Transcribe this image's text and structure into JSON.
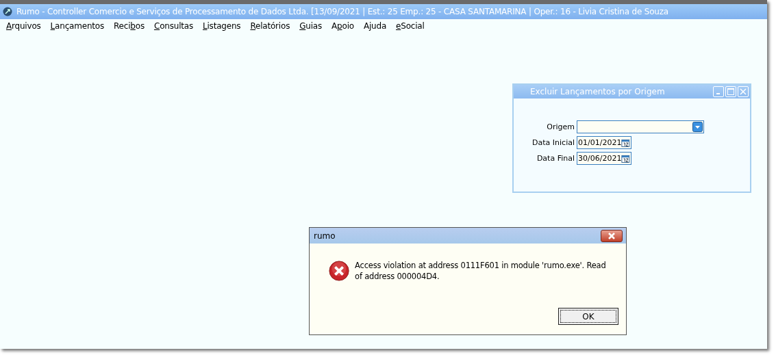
{
  "window": {
    "title": "Rumo - Controller Comercio e Serviços de Processamento de Dados Ltda. [13/09/2021 | Est.: 25 Emp.: 25 - CASA SANTAMARINA | Oper.: 16 - Livia Cristina de Souza"
  },
  "menu": [
    {
      "key": "A",
      "after": "rquivos"
    },
    {
      "key": "L",
      "after": "ançamentos"
    },
    {
      "before": "Reci",
      "key": "b",
      "after": "os"
    },
    {
      "key": "C",
      "after": "onsultas"
    },
    {
      "key": "L",
      "after": "istagens"
    },
    {
      "key": "R",
      "after": "elatórios"
    },
    {
      "key": "G",
      "after": "uias"
    },
    {
      "before": "A",
      "key": "p",
      "after": "oio"
    },
    {
      "before": "A",
      "key": "j",
      "after": "uda"
    },
    {
      "key": "e",
      "after": "Social"
    }
  ],
  "child_window": {
    "title": "Excluir Lançamentos por Origem",
    "fields": [
      {
        "kind": "dropdown",
        "label": "Origem"
      },
      {
        "kind": "date",
        "label": "Data Inicial",
        "value": "01/01/2021"
      },
      {
        "kind": "date",
        "label": "Data Final",
        "value": "30/06/2021"
      }
    ]
  },
  "dialog": {
    "title": "rumo",
    "message": "Access violation at address 0111F601 in module 'rumo.exe'. Read of address 000004D4.",
    "buttons": [
      {
        "label": "OK",
        "focused": true
      }
    ]
  }
}
